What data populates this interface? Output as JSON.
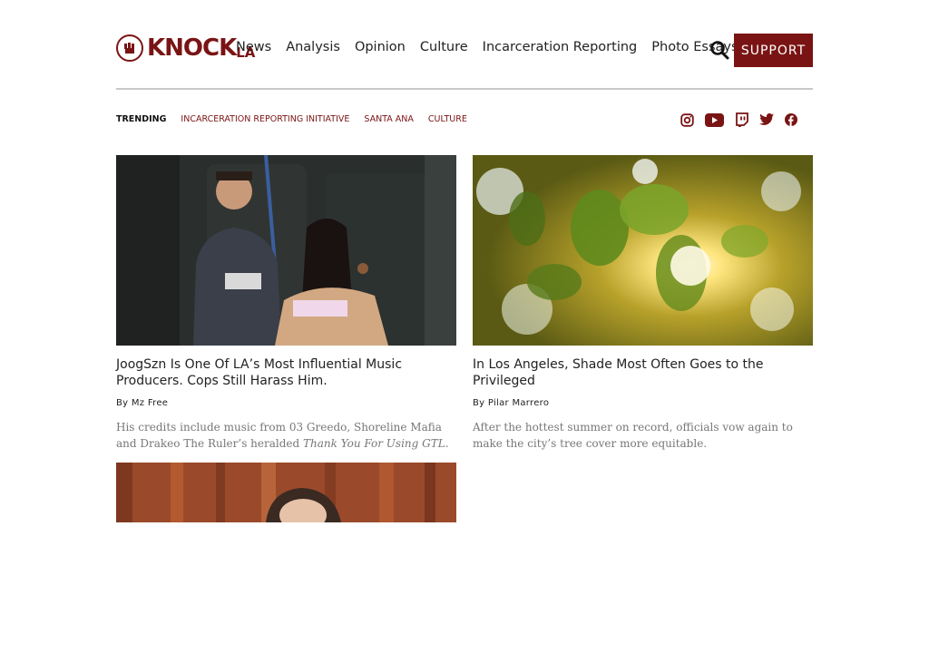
{
  "header": {
    "logo_text": "KNOCK",
    "logo_sub": "LA",
    "nav": [
      "News",
      "Analysis",
      "Opinion",
      "Culture",
      "Incarceration Reporting",
      "Photo Essays"
    ],
    "support_label": "SUPPORT"
  },
  "trending": {
    "label": "TRENDING",
    "links": [
      "INCARCERATION REPORTING INITIATIVE",
      "SANTA ANA",
      "CULTURE"
    ]
  },
  "social": [
    "instagram-icon",
    "youtube-icon",
    "twitch-icon",
    "twitter-icon",
    "facebook-icon"
  ],
  "articles": [
    {
      "title": "JoogSzn Is One Of LA’s Most Influential Music Producers. Cops Still Harass Him.",
      "byline": "By Mz Free",
      "dek_prefix": "His credits include music from 03 Greedo, Shoreline Mafia and Drakeo The Ruler’s heralded ",
      "dek_italic": "Thank You For Using GTL",
      "dek_suffix": "."
    },
    {
      "title": "In Los Angeles, Shade Most Often Goes to the Privileged",
      "byline": "By Pilar Marrero",
      "dek": "After the hottest summer on record, officials vow again to make the city’s tree cover more equitable."
    }
  ],
  "colors": {
    "brand": "#7a1414",
    "text": "#222222",
    "muted": "#777777"
  }
}
